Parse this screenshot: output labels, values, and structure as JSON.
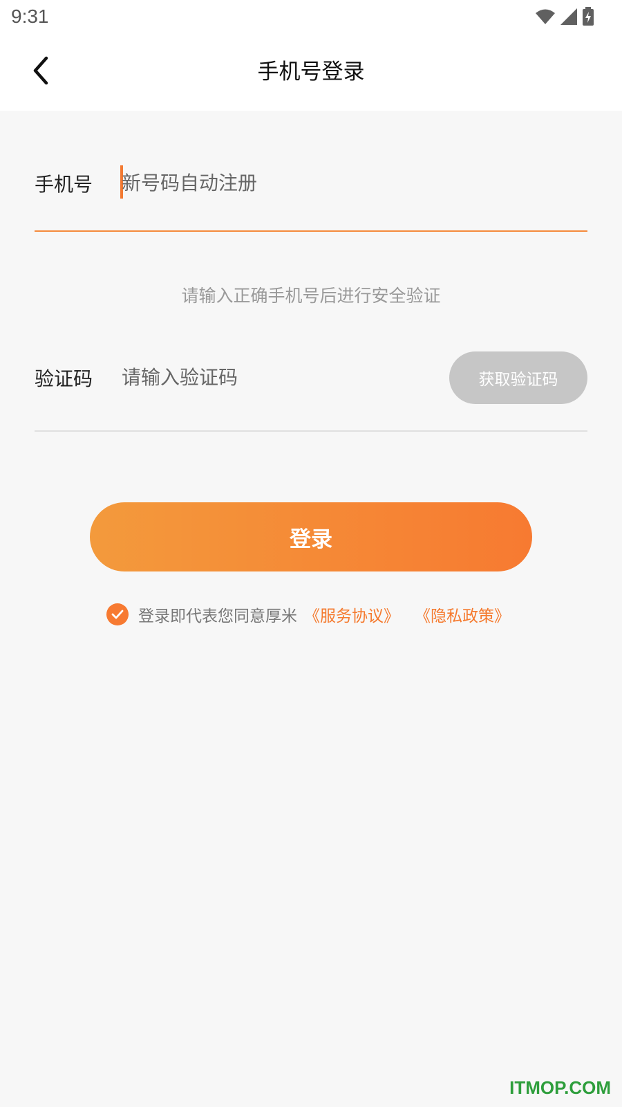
{
  "status_bar": {
    "time": "9:31",
    "icons": [
      "wifi-icon",
      "cellular-signal-icon",
      "battery-charging-icon"
    ]
  },
  "header": {
    "title": "手机号登录",
    "back_icon": "chevron-left-icon"
  },
  "phone_field": {
    "label": "手机号",
    "placeholder": "新号码自动注册",
    "value": ""
  },
  "hint": "请输入正确手机号后进行安全验证",
  "code_field": {
    "label": "验证码",
    "placeholder": "请输入验证码",
    "value": "",
    "button_label": "获取验证码"
  },
  "login_button": {
    "label": "登录"
  },
  "agreement": {
    "checked": true,
    "text": "登录即代表您同意厚米",
    "service_link": "《服务协议》",
    "privacy_link": "《隐私政策》"
  },
  "watermark": "ITMOP.COM",
  "colors": {
    "accent": "#f77a31",
    "accent_light": "#f39a3c",
    "disabled_button": "#c6c6c6",
    "background": "#f7f7f7",
    "watermark": "#2e9e3c"
  }
}
